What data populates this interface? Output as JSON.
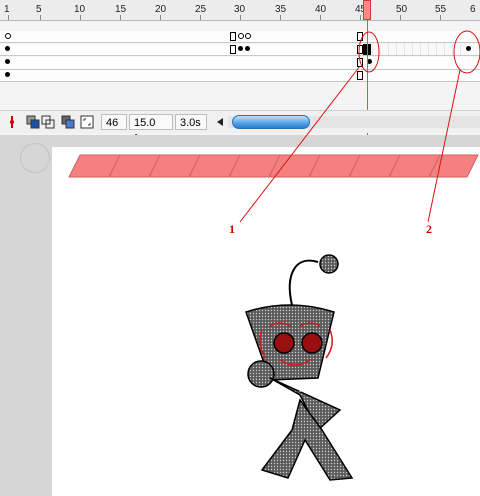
{
  "timeline": {
    "ruler_numbers": [
      "1",
      "5",
      "10",
      "15",
      "20",
      "25",
      "30",
      "35",
      "40",
      "45",
      "50",
      "55",
      "6"
    ],
    "current_frame": "46",
    "frame_rate": "15.0 fps",
    "elapsed_time": "3.0s"
  },
  "toolbar": {
    "icons": [
      "add-motion-guide-icon",
      "onion-skin-icon",
      "onion-skin-outlines-icon",
      "edit-multiple-frames-icon",
      "modify-onion-markers-icon",
      "scroll-left-icon"
    ]
  },
  "annotations": {
    "label_1": "1",
    "label_2": "2",
    "color": "#d00000"
  },
  "colors": {
    "stage_background": "#d6d6d6",
    "playhead": "#ff8a8a",
    "drawing_strip": "#f58080"
  }
}
